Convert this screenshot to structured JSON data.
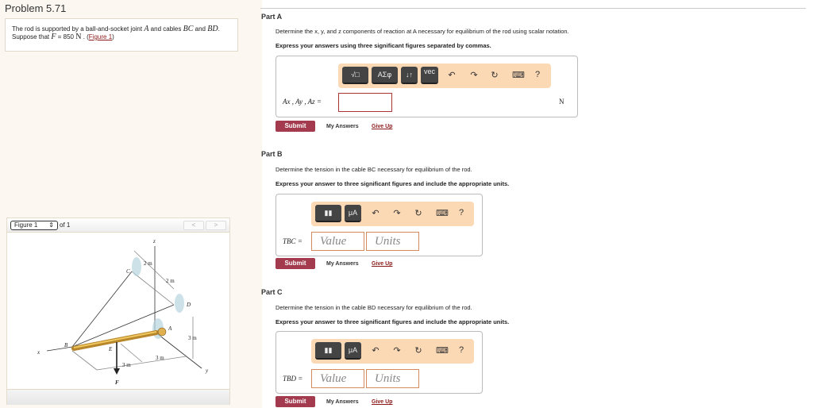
{
  "problem": {
    "title": "Problem 5.71",
    "statement_1": "The rod is supported by a ball-and-socket joint",
    "A": "A",
    "statement_2": "and cables",
    "BC": "BC",
    "statement_3": "and",
    "BD": "BD",
    "statement_4": ". Suppose that",
    "F": "F",
    "statement_5": "= 850",
    "unit": "N",
    "statement_6": ". (",
    "figure_link": "Figure 1",
    "statement_7": ")"
  },
  "figure": {
    "selector": "Figure 1",
    "of": "of 1",
    "prev": "<",
    "next": ">",
    "labels": {
      "z": "z",
      "C": "C",
      "D": "D",
      "A": "A",
      "B": "B",
      "E": "E",
      "x": "x",
      "y": "y",
      "F": "F",
      "d1": "2 m",
      "d2": "2 m",
      "d3": "3 m",
      "d4": "3 m",
      "d5": "3 m"
    }
  },
  "partA": {
    "title": "Part A",
    "question": "Determine the x, y, and z components of reaction at A necessary for equilibrium of the rod using scalar notation.",
    "instruction": "Express your answers using three significant figures separated by commas.",
    "toolbar": [
      "√□",
      "ΑΣφ",
      "↓↑",
      "vec"
    ],
    "label": "Ax , Ay , Az =",
    "value": "",
    "unit": "N",
    "submit": "Submit",
    "my_answers": "My Answers",
    "give_up": "Give Up"
  },
  "partB": {
    "title": "Part B",
    "question": "Determine the tension in the cable BC necessary for equilibrium of the rod.",
    "instruction": "Express your answer to three significant figures and include the appropriate units.",
    "toolbar": [
      "μA"
    ],
    "label": "TBC =",
    "value_placeholder": "Value",
    "units_placeholder": "Units",
    "submit": "Submit",
    "my_answers": "My Answers",
    "give_up": "Give Up"
  },
  "partC": {
    "title": "Part C",
    "question": "Determine the tension in the cable BD necessary for equilibrium of the rod.",
    "instruction": "Express your answer to three significant figures and include the appropriate units.",
    "toolbar": [
      "μA"
    ],
    "label": "TBD =",
    "value_placeholder": "Value",
    "units_placeholder": "Units",
    "submit": "Submit",
    "my_answers": "My Answers",
    "give_up": "Give Up"
  },
  "toolbar_icons": {
    "undo": "↶",
    "redo": "↷",
    "reset": "↻",
    "keyboard": "⌨",
    "help": "?"
  }
}
